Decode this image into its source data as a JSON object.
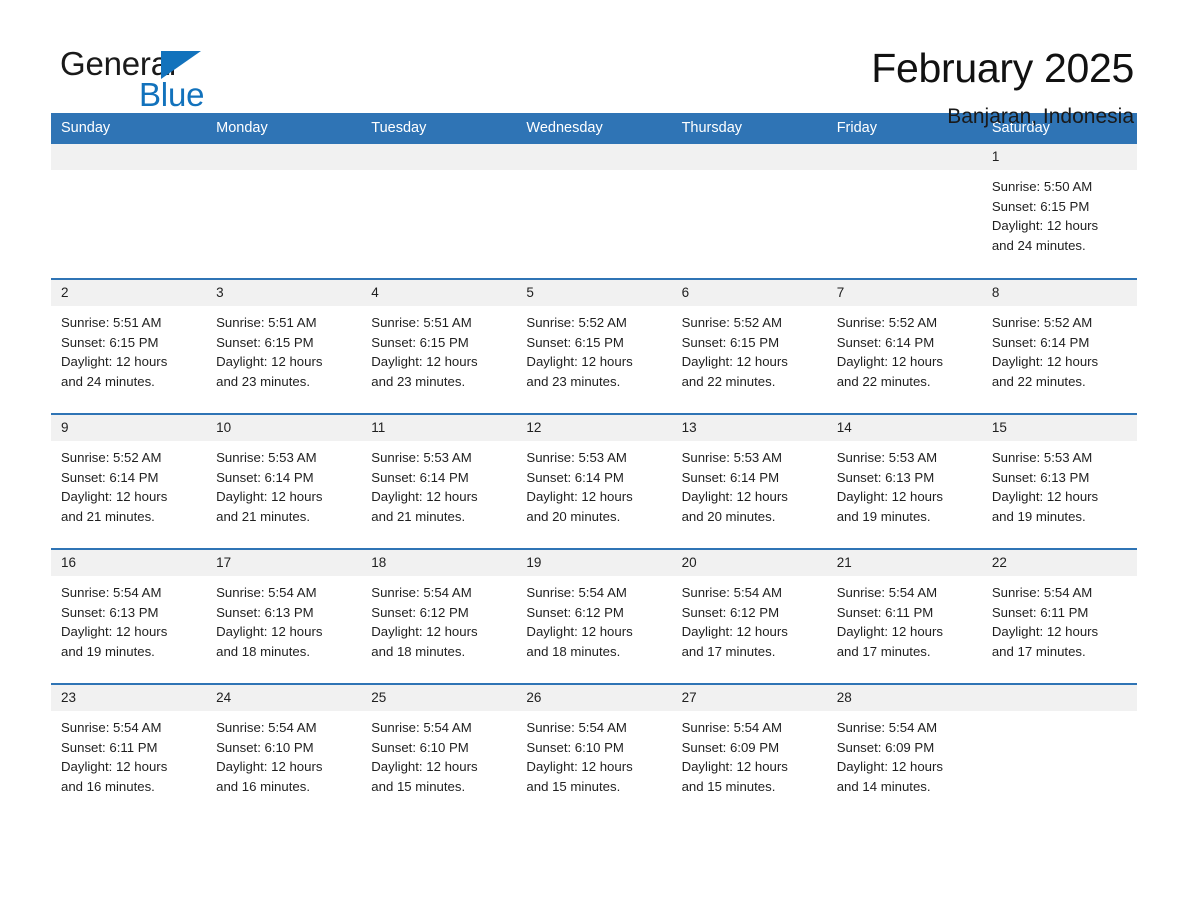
{
  "brand": {
    "name_part1": "General",
    "name_part2": "Blue",
    "triangle_icon": "blue-triangle-icon",
    "accent_color": "#1272bc"
  },
  "header": {
    "title": "February 2025",
    "location": "Banjaran, Indonesia"
  },
  "calendar": {
    "header_bg": "#2f74b5",
    "row_rule_color": "#2f74b5",
    "daynum_band_bg": "#f1f1f1",
    "weekday_labels": [
      "Sunday",
      "Monday",
      "Tuesday",
      "Wednesday",
      "Thursday",
      "Friday",
      "Saturday"
    ],
    "weeks": [
      [
        {
          "day": "",
          "sunrise": "",
          "sunset": "",
          "daylight": "",
          "daylight2": ""
        },
        {
          "day": "",
          "sunrise": "",
          "sunset": "",
          "daylight": "",
          "daylight2": ""
        },
        {
          "day": "",
          "sunrise": "",
          "sunset": "",
          "daylight": "",
          "daylight2": ""
        },
        {
          "day": "",
          "sunrise": "",
          "sunset": "",
          "daylight": "",
          "daylight2": ""
        },
        {
          "day": "",
          "sunrise": "",
          "sunset": "",
          "daylight": "",
          "daylight2": ""
        },
        {
          "day": "",
          "sunrise": "",
          "sunset": "",
          "daylight": "",
          "daylight2": ""
        },
        {
          "day": "1",
          "sunrise": "Sunrise: 5:50 AM",
          "sunset": "Sunset: 6:15 PM",
          "daylight": "Daylight: 12 hours",
          "daylight2": "and 24 minutes."
        }
      ],
      [
        {
          "day": "2",
          "sunrise": "Sunrise: 5:51 AM",
          "sunset": "Sunset: 6:15 PM",
          "daylight": "Daylight: 12 hours",
          "daylight2": "and 24 minutes."
        },
        {
          "day": "3",
          "sunrise": "Sunrise: 5:51 AM",
          "sunset": "Sunset: 6:15 PM",
          "daylight": "Daylight: 12 hours",
          "daylight2": "and 23 minutes."
        },
        {
          "day": "4",
          "sunrise": "Sunrise: 5:51 AM",
          "sunset": "Sunset: 6:15 PM",
          "daylight": "Daylight: 12 hours",
          "daylight2": "and 23 minutes."
        },
        {
          "day": "5",
          "sunrise": "Sunrise: 5:52 AM",
          "sunset": "Sunset: 6:15 PM",
          "daylight": "Daylight: 12 hours",
          "daylight2": "and 23 minutes."
        },
        {
          "day": "6",
          "sunrise": "Sunrise: 5:52 AM",
          "sunset": "Sunset: 6:15 PM",
          "daylight": "Daylight: 12 hours",
          "daylight2": "and 22 minutes."
        },
        {
          "day": "7",
          "sunrise": "Sunrise: 5:52 AM",
          "sunset": "Sunset: 6:14 PM",
          "daylight": "Daylight: 12 hours",
          "daylight2": "and 22 minutes."
        },
        {
          "day": "8",
          "sunrise": "Sunrise: 5:52 AM",
          "sunset": "Sunset: 6:14 PM",
          "daylight": "Daylight: 12 hours",
          "daylight2": "and 22 minutes."
        }
      ],
      [
        {
          "day": "9",
          "sunrise": "Sunrise: 5:52 AM",
          "sunset": "Sunset: 6:14 PM",
          "daylight": "Daylight: 12 hours",
          "daylight2": "and 21 minutes."
        },
        {
          "day": "10",
          "sunrise": "Sunrise: 5:53 AM",
          "sunset": "Sunset: 6:14 PM",
          "daylight": "Daylight: 12 hours",
          "daylight2": "and 21 minutes."
        },
        {
          "day": "11",
          "sunrise": "Sunrise: 5:53 AM",
          "sunset": "Sunset: 6:14 PM",
          "daylight": "Daylight: 12 hours",
          "daylight2": "and 21 minutes."
        },
        {
          "day": "12",
          "sunrise": "Sunrise: 5:53 AM",
          "sunset": "Sunset: 6:14 PM",
          "daylight": "Daylight: 12 hours",
          "daylight2": "and 20 minutes."
        },
        {
          "day": "13",
          "sunrise": "Sunrise: 5:53 AM",
          "sunset": "Sunset: 6:14 PM",
          "daylight": "Daylight: 12 hours",
          "daylight2": "and 20 minutes."
        },
        {
          "day": "14",
          "sunrise": "Sunrise: 5:53 AM",
          "sunset": "Sunset: 6:13 PM",
          "daylight": "Daylight: 12 hours",
          "daylight2": "and 19 minutes."
        },
        {
          "day": "15",
          "sunrise": "Sunrise: 5:53 AM",
          "sunset": "Sunset: 6:13 PM",
          "daylight": "Daylight: 12 hours",
          "daylight2": "and 19 minutes."
        }
      ],
      [
        {
          "day": "16",
          "sunrise": "Sunrise: 5:54 AM",
          "sunset": "Sunset: 6:13 PM",
          "daylight": "Daylight: 12 hours",
          "daylight2": "and 19 minutes."
        },
        {
          "day": "17",
          "sunrise": "Sunrise: 5:54 AM",
          "sunset": "Sunset: 6:13 PM",
          "daylight": "Daylight: 12 hours",
          "daylight2": "and 18 minutes."
        },
        {
          "day": "18",
          "sunrise": "Sunrise: 5:54 AM",
          "sunset": "Sunset: 6:12 PM",
          "daylight": "Daylight: 12 hours",
          "daylight2": "and 18 minutes."
        },
        {
          "day": "19",
          "sunrise": "Sunrise: 5:54 AM",
          "sunset": "Sunset: 6:12 PM",
          "daylight": "Daylight: 12 hours",
          "daylight2": "and 18 minutes."
        },
        {
          "day": "20",
          "sunrise": "Sunrise: 5:54 AM",
          "sunset": "Sunset: 6:12 PM",
          "daylight": "Daylight: 12 hours",
          "daylight2": "and 17 minutes."
        },
        {
          "day": "21",
          "sunrise": "Sunrise: 5:54 AM",
          "sunset": "Sunset: 6:11 PM",
          "daylight": "Daylight: 12 hours",
          "daylight2": "and 17 minutes."
        },
        {
          "day": "22",
          "sunrise": "Sunrise: 5:54 AM",
          "sunset": "Sunset: 6:11 PM",
          "daylight": "Daylight: 12 hours",
          "daylight2": "and 17 minutes."
        }
      ],
      [
        {
          "day": "23",
          "sunrise": "Sunrise: 5:54 AM",
          "sunset": "Sunset: 6:11 PM",
          "daylight": "Daylight: 12 hours",
          "daylight2": "and 16 minutes."
        },
        {
          "day": "24",
          "sunrise": "Sunrise: 5:54 AM",
          "sunset": "Sunset: 6:10 PM",
          "daylight": "Daylight: 12 hours",
          "daylight2": "and 16 minutes."
        },
        {
          "day": "25",
          "sunrise": "Sunrise: 5:54 AM",
          "sunset": "Sunset: 6:10 PM",
          "daylight": "Daylight: 12 hours",
          "daylight2": "and 15 minutes."
        },
        {
          "day": "26",
          "sunrise": "Sunrise: 5:54 AM",
          "sunset": "Sunset: 6:10 PM",
          "daylight": "Daylight: 12 hours",
          "daylight2": "and 15 minutes."
        },
        {
          "day": "27",
          "sunrise": "Sunrise: 5:54 AM",
          "sunset": "Sunset: 6:09 PM",
          "daylight": "Daylight: 12 hours",
          "daylight2": "and 15 minutes."
        },
        {
          "day": "28",
          "sunrise": "Sunrise: 5:54 AM",
          "sunset": "Sunset: 6:09 PM",
          "daylight": "Daylight: 12 hours",
          "daylight2": "and 14 minutes."
        },
        {
          "day": "",
          "sunrise": "",
          "sunset": "",
          "daylight": "",
          "daylight2": ""
        }
      ]
    ]
  }
}
